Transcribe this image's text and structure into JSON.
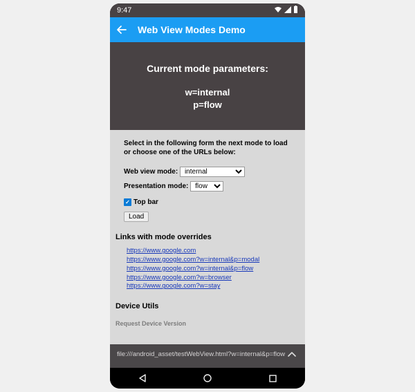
{
  "status": {
    "time": "9:47"
  },
  "appbar": {
    "title": "Web View Modes Demo"
  },
  "hero": {
    "title": "Current mode parameters:",
    "line1": "w=internal",
    "line2": "p=flow"
  },
  "form": {
    "instruction": "Select in the following form the next mode to load or choose one of the URLs below:",
    "webview_label": "Web view mode:",
    "webview_value": "internal",
    "presentation_label": "Presentation mode:",
    "presentation_value": "flow",
    "topbar_label": "Top bar",
    "topbar_checked": true,
    "load_label": "Load"
  },
  "sections": {
    "links_title": "Links with mode overrides",
    "device_title": "Device Utils",
    "ghost_line": "Request Device Version"
  },
  "links": [
    "https://www.google.com",
    "https://www.google.com?w=internal&p=modal",
    "https://www.google.com?w=internal&p=flow",
    "https://www.google.com?w=browser",
    "https://www.google.com?w=stay"
  ],
  "footer": {
    "url": "file:///android_asset/testWebView.html?w=internal&p=flow"
  }
}
